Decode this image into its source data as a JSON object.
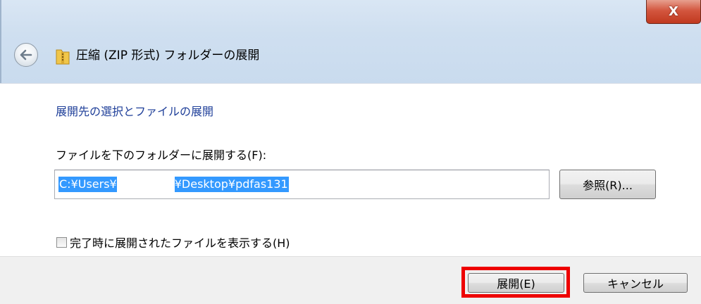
{
  "window": {
    "title": "圧縮 (ZIP 形式) フォルダーの展開",
    "close_label": "X"
  },
  "content": {
    "heading": "展開先の選択とファイルの展開",
    "destination_label": "ファイルを下のフォルダーに展開する(F):",
    "destination_value_prefix": "C:¥Users¥",
    "destination_value_suffix": "¥Desktop¥pdfas131",
    "browse_label": "参照(R)...",
    "show_files_label": "完了時に展開されたファイルを表示する(H)",
    "show_files_checked": false
  },
  "footer": {
    "extract_label": "展開(E)",
    "cancel_label": "キャンセル",
    "highlight_color": "#ee0000"
  },
  "colors": {
    "heading": "#1f3f99",
    "selection": "#3399ff"
  }
}
